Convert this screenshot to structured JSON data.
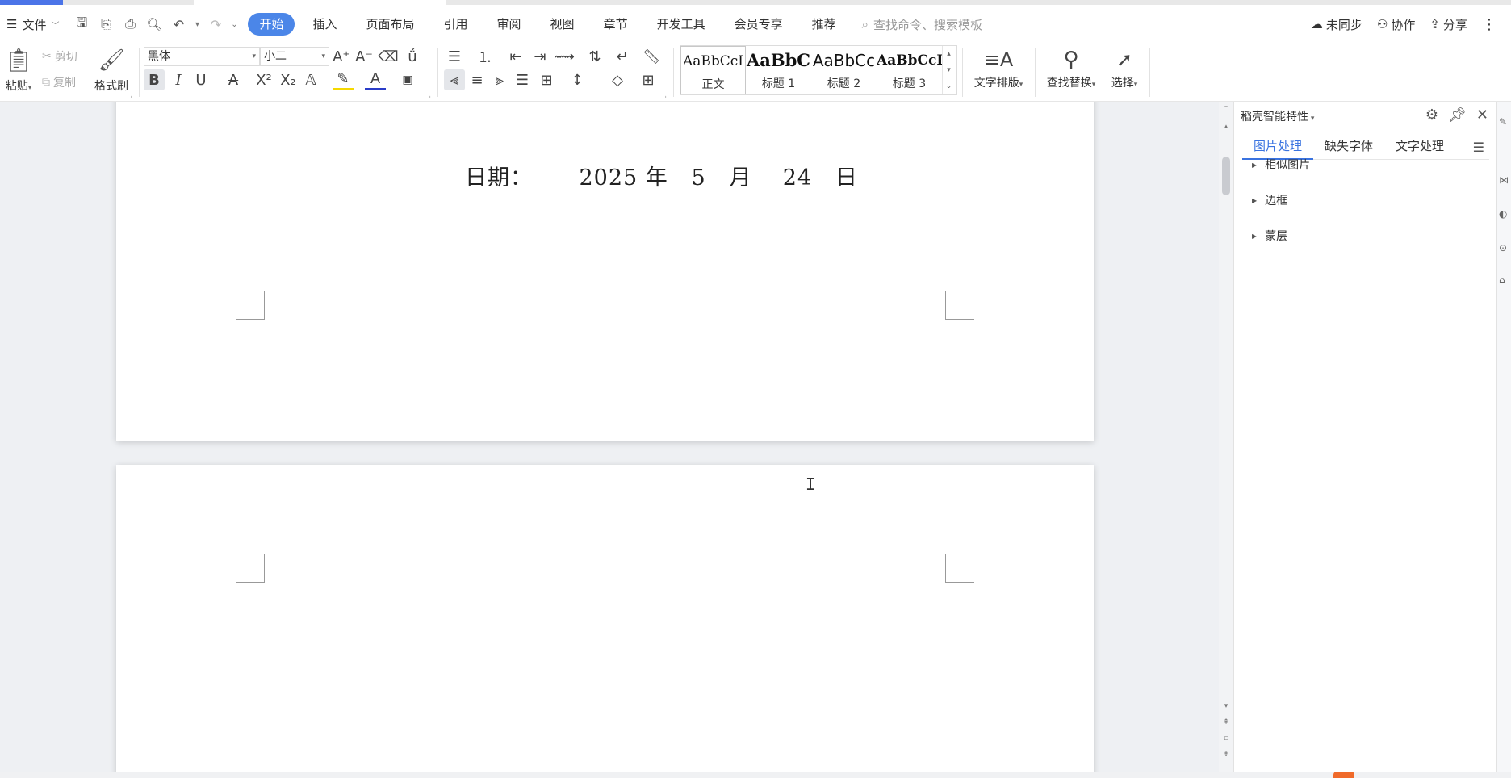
{
  "menubar": {
    "file_label": "文件",
    "tabs": [
      "开始",
      "插入",
      "页面布局",
      "引用",
      "审阅",
      "视图",
      "章节",
      "开发工具",
      "会员专享",
      "推荐"
    ],
    "search_placeholder": "查找命令、搜索模板",
    "sync_label": "未同步",
    "collab_label": "协作",
    "share_label": "分享"
  },
  "ribbon": {
    "paste": "粘贴",
    "cut": "剪切",
    "copy": "复制",
    "format_painter": "格式刷",
    "font_name": "黑体",
    "font_size": "小二",
    "styles": [
      {
        "preview": "AaBbCcI",
        "name": "正文"
      },
      {
        "preview": "AaBbC",
        "name": "标题 1"
      },
      {
        "preview": "AaBbCc",
        "name": "标题 2"
      },
      {
        "preview": "AaBbCcI",
        "name": "标题 3"
      }
    ],
    "text_layout": "文字排版",
    "find_replace": "查找替换",
    "select": "选择"
  },
  "document": {
    "date_line": "日期：      2025 年   5   月    24   日"
  },
  "panel": {
    "title": "稻壳智能特性",
    "tabs": [
      "图片处理",
      "缺失字体",
      "文字处理"
    ],
    "items": [
      "相似图片",
      "边框",
      "蒙层"
    ]
  },
  "colors": {
    "accent": "#4b86e8",
    "panel_active": "#3a73e0",
    "font_color_bar": "#2a3cc8",
    "highlight_bar": "#f5d800"
  }
}
